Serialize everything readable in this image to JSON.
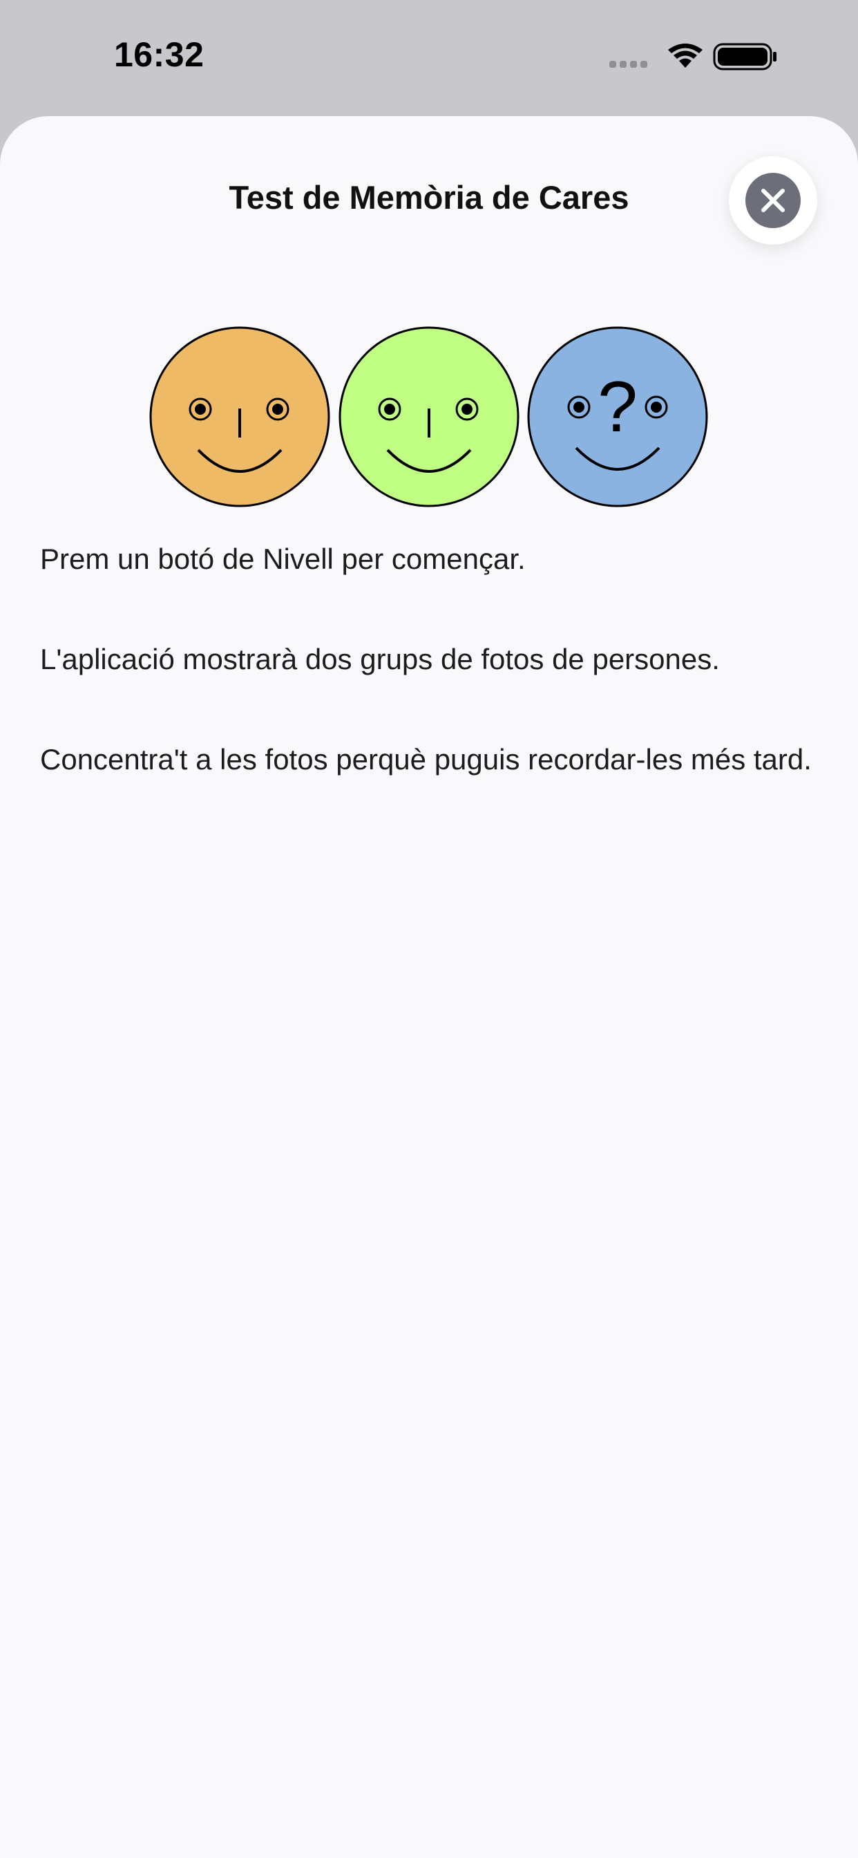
{
  "status_bar": {
    "time": "16:32",
    "icons": [
      "signal-dots-icon",
      "wifi-icon",
      "battery-icon"
    ]
  },
  "sheet": {
    "title": "Test de Memòria de Cares",
    "close_icon": "close-icon",
    "faces": [
      {
        "color": "#efba66",
        "expression": "smile"
      },
      {
        "color": "#c0fe83",
        "expression": "smile"
      },
      {
        "color": "#8ab3e1",
        "expression": "question",
        "mark": "?"
      }
    ],
    "paragraphs": [
      "Prem un botó de Nivell per començar.",
      "L'aplicació mostrarà dos grups de fotos de persones.",
      "Concentra't a les fotos perquè puguis recordar-les més tard."
    ]
  }
}
